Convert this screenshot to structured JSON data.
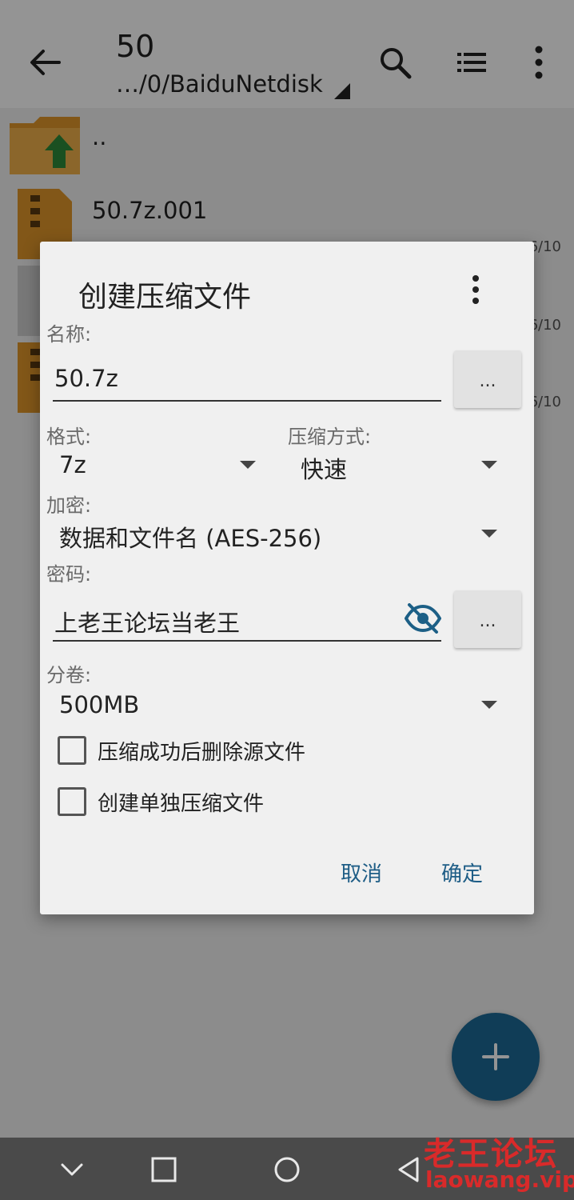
{
  "appbar": {
    "title": "50",
    "path": "…/0/BaiduNetdisk",
    "icons": [
      "back-arrow-icon",
      "search-icon",
      "list-view-icon",
      "more-vert-icon"
    ]
  },
  "files": [
    {
      "name": "..",
      "icon": "folder-up-icon"
    },
    {
      "name": "50.7z.001",
      "icon": "archive-file-icon",
      "date": "6/10"
    },
    {
      "name": "",
      "icon": "file-icon",
      "date": "6/10"
    },
    {
      "name": "",
      "icon": "archive-file-icon",
      "date": "6/10"
    }
  ],
  "dialog": {
    "title": "创建压缩文件",
    "name_label": "名称:",
    "name_value": "50.7z",
    "browse_label": "...",
    "format_label": "格式:",
    "format_value": "7z",
    "method_label": "压缩方式:",
    "method_value": "快速",
    "encrypt_label": "加密:",
    "encrypt_value": "数据和文件名 (AES-256)",
    "password_label": "密码:",
    "password_value": "上老王论坛当老王",
    "split_label": "分卷:",
    "split_value": "500MB",
    "option_delete_label": "压缩成功后删除源文件",
    "option_separate_label": "创建单独压缩文件",
    "cancel_label": "取消",
    "ok_label": "确定"
  },
  "watermark": {
    "line1": "老王论坛",
    "line2": "laowang.vip"
  },
  "colors": {
    "accent": "#1c6a96",
    "dialog_button_text": "#1e5d86",
    "folder": "#e0962a",
    "watermark": "#d92a2a"
  }
}
